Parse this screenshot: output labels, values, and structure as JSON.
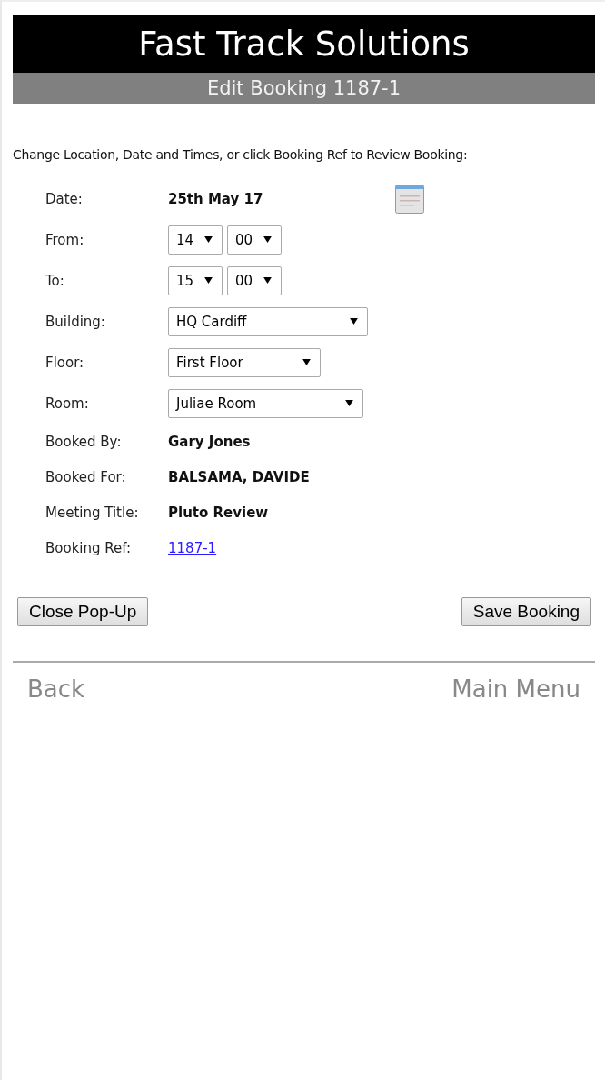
{
  "header": {
    "title": "Fast Track Solutions",
    "subtitle": "Edit Booking 1187-1"
  },
  "instruction": "Change Location, Date and Times, or click Booking Ref to Review Booking:",
  "fields": [
    {
      "kind": "date",
      "label": "Date:",
      "value": "25th May 17"
    },
    {
      "kind": "time",
      "label": "From:",
      "hour": "14",
      "minute": "00"
    },
    {
      "kind": "time",
      "label": "To:",
      "hour": "15",
      "minute": "00"
    },
    {
      "kind": "select",
      "label": "Building:",
      "value": "HQ Cardiff"
    },
    {
      "kind": "select",
      "label": "Floor:",
      "value": "First Floor"
    },
    {
      "kind": "select",
      "label": "Room:",
      "value": "Juliae Room"
    },
    {
      "kind": "text",
      "label": "Booked By:",
      "value": "Gary Jones"
    },
    {
      "kind": "text",
      "label": "Booked For:",
      "value": "BALSAMA, DAVIDE"
    },
    {
      "kind": "text",
      "label": "Meeting Title:",
      "value": "Pluto Review"
    },
    {
      "kind": "link",
      "label": "Booking Ref:",
      "value": "1187-1"
    }
  ],
  "buttons": {
    "left": "Close Pop-Up",
    "right": "Save Booking"
  },
  "nav": {
    "back": "Back",
    "menu": "Main Menu"
  }
}
